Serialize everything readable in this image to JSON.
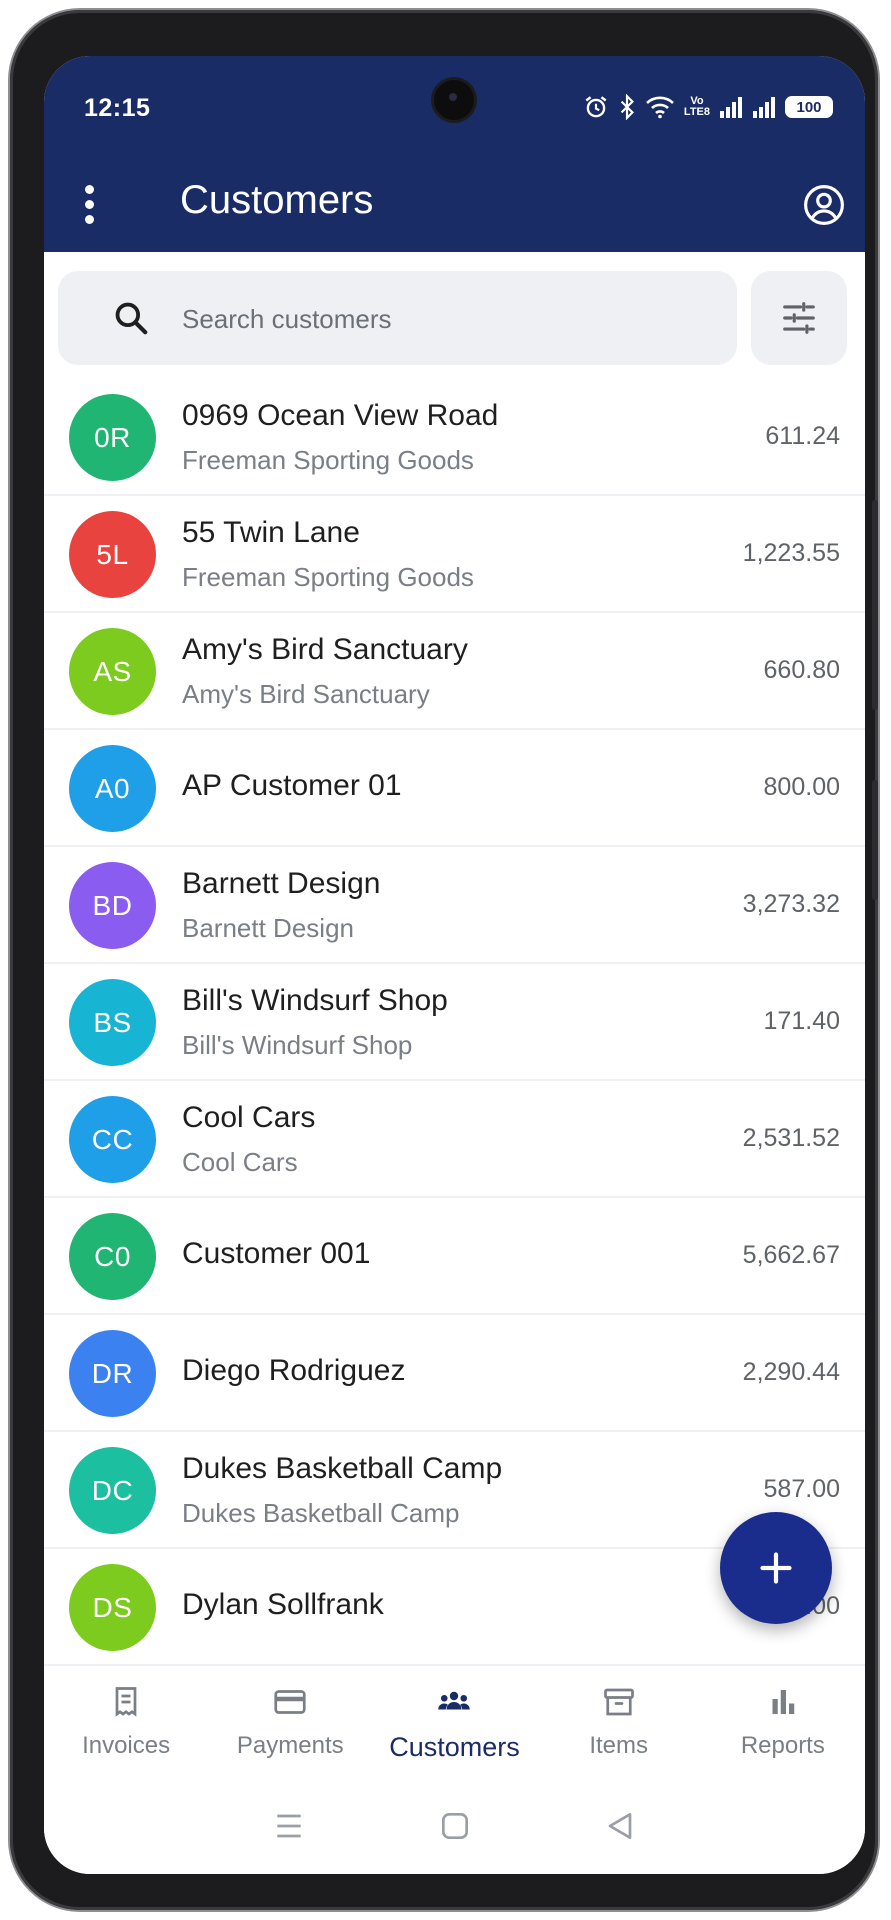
{
  "status_bar": {
    "time": "12:15",
    "battery": "100",
    "volte_top": "Vo",
    "volte_bottom": "LTE8"
  },
  "app_bar": {
    "title": "Customers"
  },
  "search": {
    "placeholder": "Search customers"
  },
  "customers": [
    {
      "initials": "0R",
      "name": "0969 Ocean View Road",
      "company": "Freeman Sporting Goods",
      "amount": "611.24",
      "color": "#21b573"
    },
    {
      "initials": "5L",
      "name": "55 Twin Lane",
      "company": "Freeman Sporting Goods",
      "amount": "1,223.55",
      "color": "#e8433f"
    },
    {
      "initials": "AS",
      "name": "Amy's Bird Sanctuary",
      "company": "Amy's Bird Sanctuary",
      "amount": "660.80",
      "color": "#7dcb1e"
    },
    {
      "initials": "A0",
      "name": "AP Customer 01",
      "company": "",
      "amount": "800.00",
      "color": "#1e9fe8"
    },
    {
      "initials": "BD",
      "name": "Barnett Design",
      "company": "Barnett Design",
      "amount": "3,273.32",
      "color": "#8b5cf0"
    },
    {
      "initials": "BS",
      "name": "Bill's Windsurf Shop",
      "company": "Bill's Windsurf Shop",
      "amount": "171.40",
      "color": "#17b4d3"
    },
    {
      "initials": "CC",
      "name": "Cool Cars",
      "company": "Cool Cars",
      "amount": "2,531.52",
      "color": "#1e9fe8"
    },
    {
      "initials": "C0",
      "name": "Customer 001",
      "company": "",
      "amount": "5,662.67",
      "color": "#21b573"
    },
    {
      "initials": "DR",
      "name": "Diego Rodriguez",
      "company": "",
      "amount": "2,290.44",
      "color": "#3b82f0"
    },
    {
      "initials": "DC",
      "name": "Dukes Basketball Camp",
      "company": "Dukes Basketball Camp",
      "amount": "587.00",
      "color": "#1cbfa0"
    },
    {
      "initials": "DS",
      "name": "Dylan Sollfrank",
      "company": "",
      "amount": "0.00",
      "color": "#7dcb1e"
    }
  ],
  "bottom_nav": [
    {
      "label": "Invoices",
      "icon": "invoice-icon",
      "active": false
    },
    {
      "label": "Payments",
      "icon": "credit-card-icon",
      "active": false
    },
    {
      "label": "Customers",
      "icon": "people-icon",
      "active": true
    },
    {
      "label": "Items",
      "icon": "archive-box-icon",
      "active": false
    },
    {
      "label": "Reports",
      "icon": "bar-chart-icon",
      "active": false
    }
  ],
  "colors": {
    "primary": "#1a2c66",
    "fab": "#1a2c8c",
    "search_bg": "#eef0f3"
  }
}
